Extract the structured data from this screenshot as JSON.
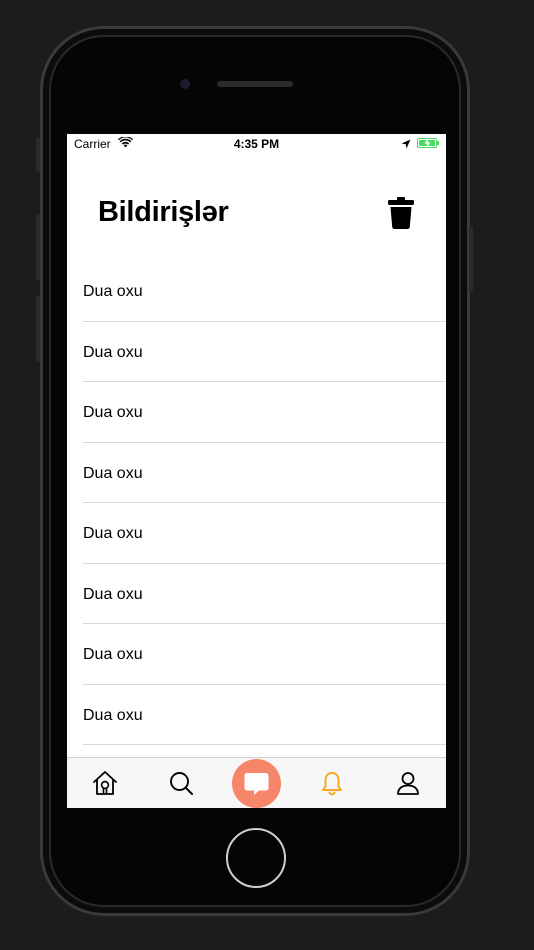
{
  "status_bar": {
    "carrier": "Carrier",
    "time": "4:35 PM"
  },
  "header": {
    "title": "Bildirişlər"
  },
  "notifications": [
    {
      "label": "Dua oxu"
    },
    {
      "label": "Dua oxu"
    },
    {
      "label": "Dua oxu"
    },
    {
      "label": "Dua oxu"
    },
    {
      "label": "Dua oxu"
    },
    {
      "label": "Dua oxu"
    },
    {
      "label": "Dua oxu"
    },
    {
      "label": "Dua oxu"
    }
  ],
  "tab_bar": {
    "tabs": [
      {
        "icon": "home-icon",
        "active": false
      },
      {
        "icon": "search-icon",
        "active": false
      },
      {
        "icon": "chat-icon",
        "active": false,
        "highlighted": true
      },
      {
        "icon": "bell-icon",
        "active": true
      },
      {
        "icon": "profile-icon",
        "active": false
      }
    ]
  },
  "colors": {
    "accent": "#f6866a",
    "active_tab": "#f5a623",
    "battery": "#4cd964"
  }
}
